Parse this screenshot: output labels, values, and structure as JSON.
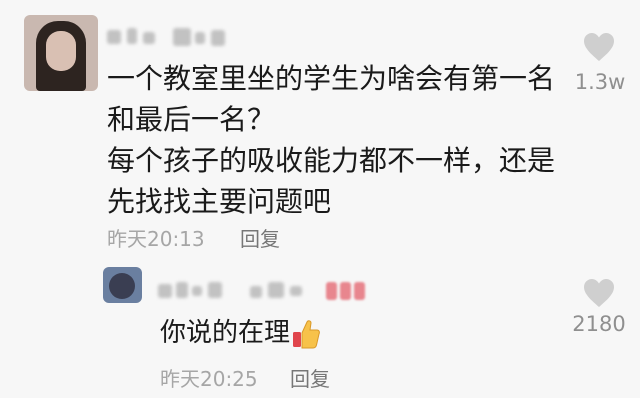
{
  "comment": {
    "text_lines": [
      "一个教室里坐的学生为啥会有第一名",
      "和最后一名？",
      "每个孩子的吸收能力都不一样，还是",
      "先找找主要问题吧"
    ],
    "time": "昨天20:13",
    "reply_label": "回复",
    "like_count": "1.3w"
  },
  "reply": {
    "text": "你说的在理",
    "time": "昨天20:25",
    "reply_label": "回复",
    "like_count": "2180"
  },
  "icons": {
    "like": "heart-icon",
    "thumbs_up": "thumbs-up-emoji"
  },
  "colors": {
    "background": "#f7f7f7",
    "text": "#1a1a1a",
    "meta": "#a6a6a6",
    "heart": "#cfcfcf"
  }
}
